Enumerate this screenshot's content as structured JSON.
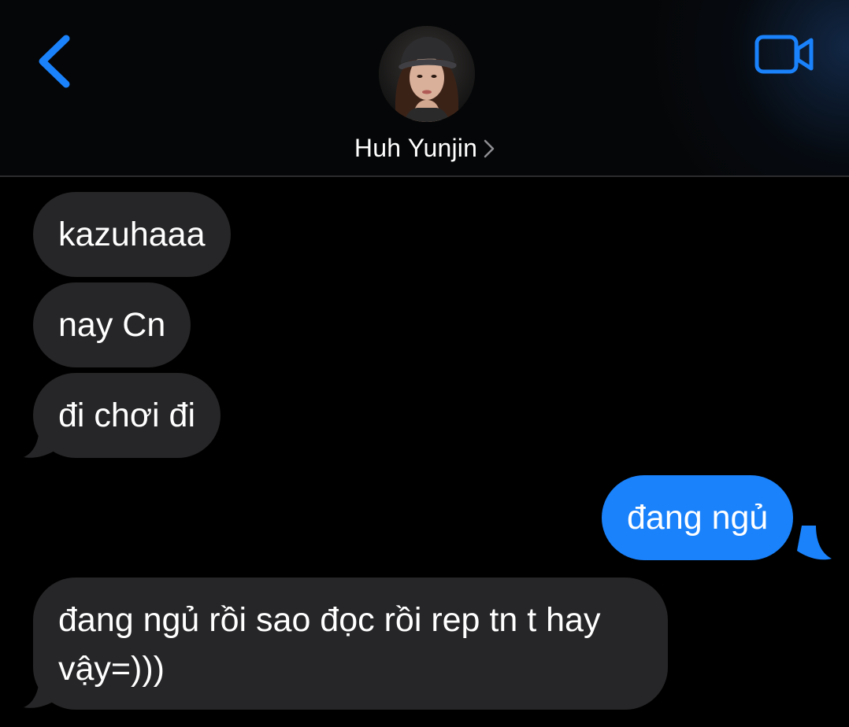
{
  "header": {
    "contact_name": "Huh Yunjin",
    "back_icon": "chevron-left-icon",
    "video_icon": "video-camera-icon",
    "chevron_icon": "chevron-right-icon",
    "accent_color": "#1a82fb"
  },
  "messages": [
    {
      "direction": "incoming",
      "text": "kazuhaaa"
    },
    {
      "direction": "incoming",
      "text": "nay Cn"
    },
    {
      "direction": "incoming",
      "text": "đi chơi đi"
    },
    {
      "direction": "outgoing",
      "text": "đang ngủ"
    },
    {
      "direction": "incoming",
      "text": "đang ngủ rồi sao đọc rồi rep tn t hay vậy=)))"
    }
  ],
  "colors": {
    "incoming_bubble": "#262628",
    "outgoing_bubble": "#1a82fb",
    "background": "#000000"
  }
}
